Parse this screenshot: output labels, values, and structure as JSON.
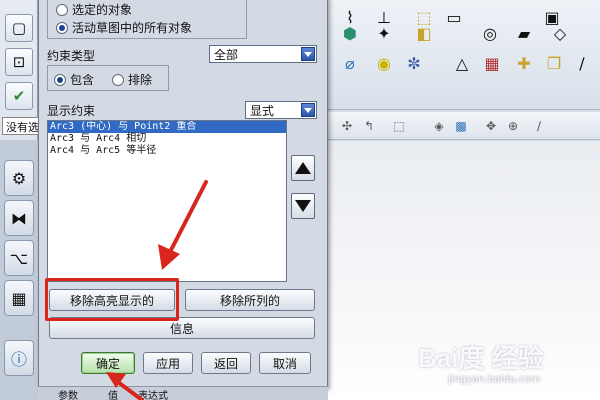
{
  "selection": {
    "option_selected": "选定的对象",
    "option_all_active": "活动草图中的所有对象",
    "active_option": "option_all_active"
  },
  "constraint_type": {
    "label": "约束类型",
    "dropdown_value": "全部",
    "include_label": "包含",
    "exclude_label": "排除",
    "active": "include"
  },
  "display": {
    "label": "显示约束",
    "dropdown_value": "显式"
  },
  "constraints_list": [
    "Arc3 (中心) 与 Point2 重合",
    "Arc3 与 Arc4 相切",
    "Arc4 与 Arc5 等半径"
  ],
  "buttons": {
    "remove_highlighted": "移除高亮显示的",
    "remove_all_listed": "移除所列的",
    "info": "信息",
    "ok": "确定",
    "apply": "应用",
    "back": "返回",
    "cancel": "取消"
  },
  "bottom_bar": {
    "col_params": "参数",
    "col_value": "值",
    "col_expression": "表达式"
  },
  "toolbar": {
    "filter_value": "没有选"
  },
  "watermark": {
    "logo": "Bai度 经验",
    "url": "jingyan.baidu.com"
  },
  "colors": {
    "annotation_red": "#d9261c",
    "selection_blue": "#316ac5",
    "ok_green": "#3d7a33"
  }
}
